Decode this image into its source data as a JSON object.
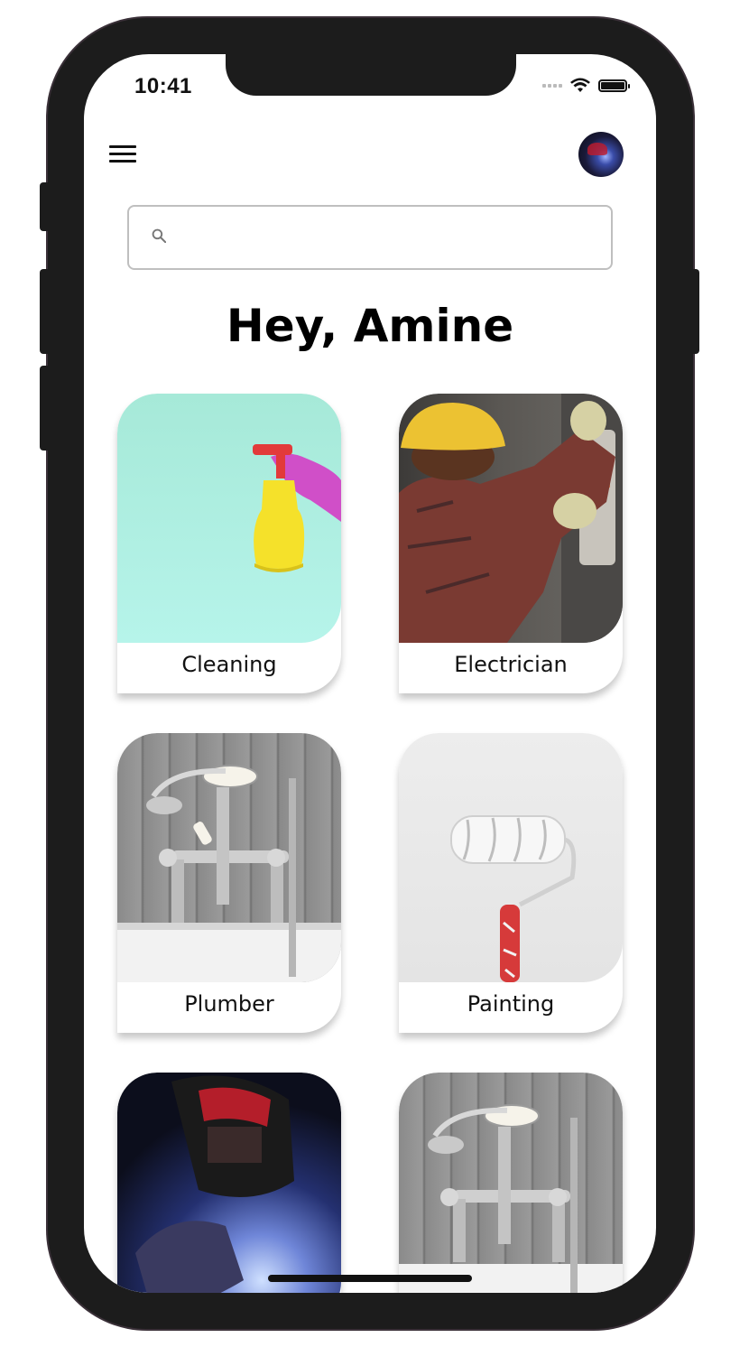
{
  "status_bar": {
    "time": "10:41"
  },
  "header": {
    "menu_icon": "hamburger-menu-icon",
    "avatar": "user-avatar"
  },
  "search": {
    "placeholder": "",
    "value": "",
    "icon": "search-icon"
  },
  "greeting": "Hey, Amine",
  "services": [
    {
      "label": "Cleaning"
    },
    {
      "label": "Electrician"
    },
    {
      "label": "Plumber"
    },
    {
      "label": "Painting"
    },
    {
      "label": ""
    },
    {
      "label": ""
    }
  ],
  "colors": {
    "frame": "#1c1c1c",
    "text": "#111111",
    "search_border": "#bfbfbf",
    "cleaning_bg": "#b4f0e6"
  }
}
